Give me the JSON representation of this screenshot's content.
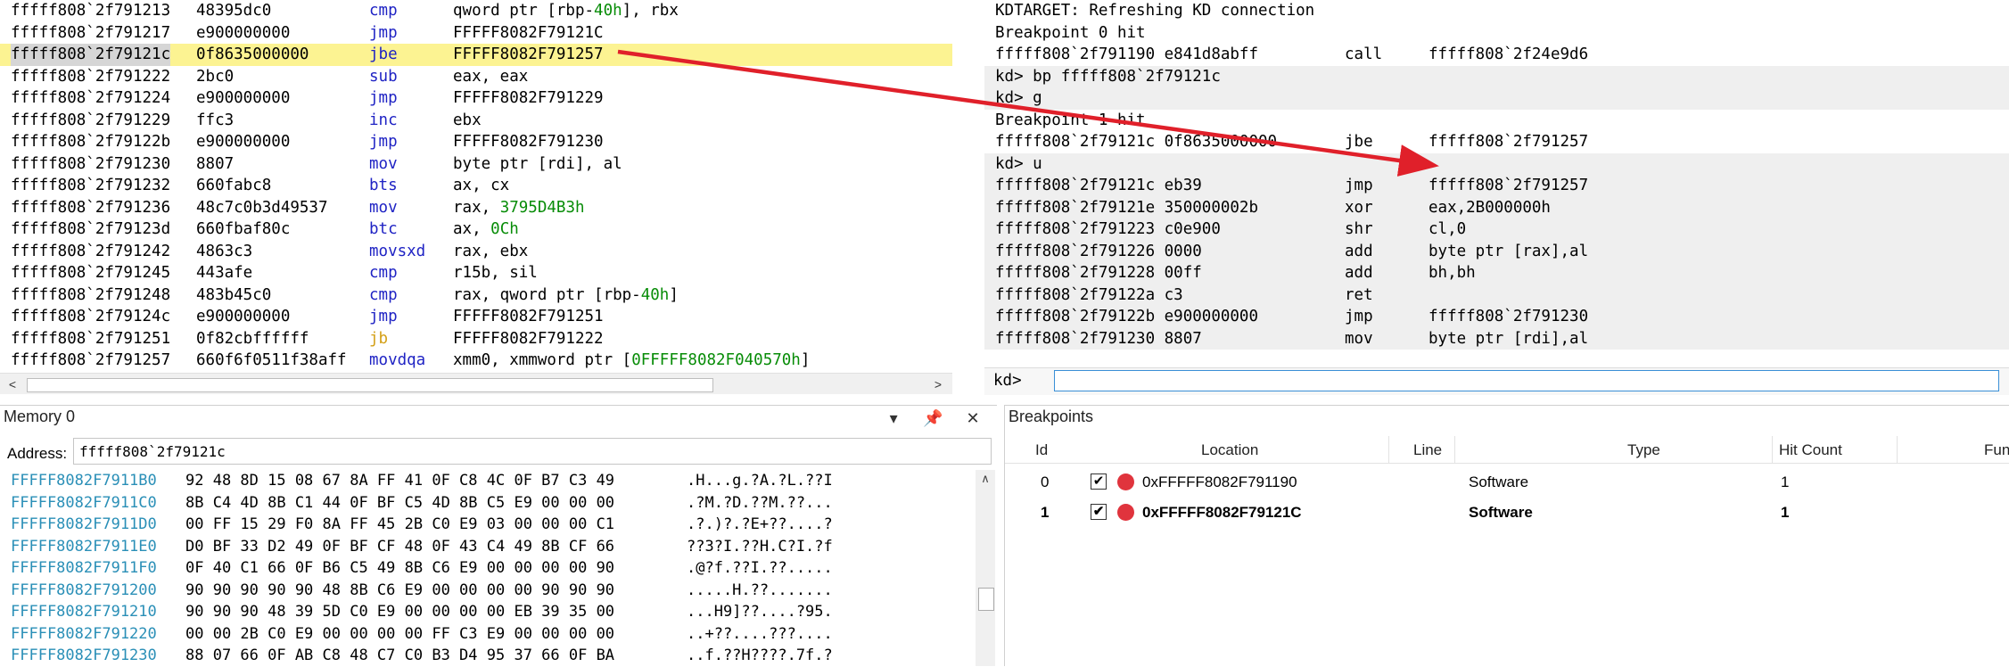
{
  "disassembly": {
    "lines": [
      {
        "addr": "fffff808`2f791213",
        "bytes": "48395dc0",
        "mn": "cmp",
        "op": [
          {
            "t": "qword ptr [rbp-"
          },
          {
            "t": "40h",
            "n": true
          },
          {
            "t": "], rbx"
          }
        ]
      },
      {
        "addr": "fffff808`2f791217",
        "bytes": "e900000000",
        "mn": "jmp",
        "op": [
          {
            "t": "FFFFF8082F79121C"
          }
        ]
      },
      {
        "addr": "fffff808`2f79121c",
        "bytes": "0f8635000000",
        "mn": "jbe",
        "op": [
          {
            "t": "FFFFF8082F791257"
          }
        ],
        "hl": true
      },
      {
        "addr": "fffff808`2f791222",
        "bytes": "2bc0",
        "mn": "sub",
        "op": [
          {
            "t": "eax, eax"
          }
        ]
      },
      {
        "addr": "fffff808`2f791224",
        "bytes": "e900000000",
        "mn": "jmp",
        "op": [
          {
            "t": "FFFFF8082F791229"
          }
        ]
      },
      {
        "addr": "fffff808`2f791229",
        "bytes": "ffc3",
        "mn": "inc",
        "op": [
          {
            "t": "ebx"
          }
        ]
      },
      {
        "addr": "fffff808`2f79122b",
        "bytes": "e900000000",
        "mn": "jmp",
        "op": [
          {
            "t": "FFFFF8082F791230"
          }
        ]
      },
      {
        "addr": "fffff808`2f791230",
        "bytes": "8807",
        "mn": "mov",
        "op": [
          {
            "t": "byte ptr [rdi], al"
          }
        ]
      },
      {
        "addr": "fffff808`2f791232",
        "bytes": "660fabc8",
        "mn": "bts",
        "op": [
          {
            "t": "ax, cx"
          }
        ]
      },
      {
        "addr": "fffff808`2f791236",
        "bytes": "48c7c0b3d49537",
        "mn": "mov",
        "op": [
          {
            "t": "rax, "
          },
          {
            "t": "3795D4B3h",
            "n": true
          }
        ]
      },
      {
        "addr": "fffff808`2f79123d",
        "bytes": "660fbaf80c",
        "mn": "btc",
        "op": [
          {
            "t": "ax, "
          },
          {
            "t": "0Ch",
            "n": true
          }
        ]
      },
      {
        "addr": "fffff808`2f791242",
        "bytes": "4863c3",
        "mn": "movsxd",
        "op": [
          {
            "t": "rax, ebx"
          }
        ]
      },
      {
        "addr": "fffff808`2f791245",
        "bytes": "443afe",
        "mn": "cmp",
        "op": [
          {
            "t": "r15b, sil"
          }
        ]
      },
      {
        "addr": "fffff808`2f791248",
        "bytes": "483b45c0",
        "mn": "cmp",
        "op": [
          {
            "t": "rax, qword ptr [rbp-"
          },
          {
            "t": "40h",
            "n": true
          },
          {
            "t": "]"
          }
        ]
      },
      {
        "addr": "fffff808`2f79124c",
        "bytes": "e900000000",
        "mn": "jmp",
        "op": [
          {
            "t": "FFFFF8082F791251"
          }
        ]
      },
      {
        "addr": "fffff808`2f791251",
        "bytes": "0f82cbffffff",
        "mn": "jb",
        "kw": true,
        "op": [
          {
            "t": "FFFFF8082F791222"
          }
        ]
      },
      {
        "addr": "fffff808`2f791257",
        "bytes": "660f6f0511f38aff",
        "mn": "movdqa",
        "op": [
          {
            "t": "xmm0, xmmword ptr ["
          },
          {
            "t": "0FFFFF8082F040570h",
            "n": true
          },
          {
            "t": "]"
          }
        ]
      }
    ]
  },
  "command": {
    "lines": [
      {
        "text": "KDTARGET: Refreshing KD connection",
        "shade": false
      },
      {
        "text": "Breakpoint 0 hit",
        "shade": false
      },
      {
        "cols": [
          "fffff808`2f791190 e841d8abff",
          "call",
          "fffff808`2f24e9d6"
        ],
        "shade": false
      },
      {
        "text": "kd> bp fffff808`2f79121c",
        "shade": true
      },
      {
        "text": "kd> g",
        "shade": true
      },
      {
        "text": "Breakpoint 1 hit",
        "shade": false
      },
      {
        "cols": [
          "fffff808`2f79121c 0f8635000000",
          "jbe",
          "fffff808`2f791257"
        ],
        "shade": false
      },
      {
        "text": "kd> u",
        "shade": true
      },
      {
        "cols": [
          "fffff808`2f79121c eb39",
          "jmp",
          "fffff808`2f791257"
        ],
        "shade": true
      },
      {
        "cols": [
          "fffff808`2f79121e 350000002b",
          "xor",
          "eax,2B000000h"
        ],
        "shade": true
      },
      {
        "cols": [
          "fffff808`2f791223 c0e900",
          "shr",
          "cl,0"
        ],
        "shade": true
      },
      {
        "cols": [
          "fffff808`2f791226 0000",
          "add",
          "byte ptr [rax],al"
        ],
        "shade": true
      },
      {
        "cols": [
          "fffff808`2f791228 00ff",
          "add",
          "bh,bh"
        ],
        "shade": true
      },
      {
        "cols": [
          "fffff808`2f79122a c3",
          "ret",
          ""
        ],
        "shade": true
      },
      {
        "cols": [
          "fffff808`2f79122b e900000000",
          "jmp",
          "fffff808`2f791230"
        ],
        "shade": true
      },
      {
        "cols": [
          "fffff808`2f791230 8807",
          "mov",
          "byte ptr [rdi],al"
        ],
        "shade": true
      }
    ],
    "prompt": "kd>",
    "input_value": ""
  },
  "memory": {
    "title": "Memory 0",
    "address_label": "Address:",
    "address_value": "fffff808`2f79121c",
    "rows": [
      {
        "addr": "FFFFF8082F7911B0",
        "bytes": "92 48 8D 15 08 67 8A FF 41 0F C8 4C 0F B7 C3 49",
        "ascii": ".H...g.?A.?L.??I"
      },
      {
        "addr": "FFFFF8082F7911C0",
        "bytes": "8B C4 4D 8B C1 44 0F BF C5 4D 8B C5 E9 00 00 00",
        "ascii": ".?M.?D.??M.??..."
      },
      {
        "addr": "FFFFF8082F7911D0",
        "bytes": "00 FF 15 29 F0 8A FF 45 2B C0 E9 03 00 00 00 C1",
        "ascii": ".?.)?.?E+??....?"
      },
      {
        "addr": "FFFFF8082F7911E0",
        "bytes": "D0 BF 33 D2 49 0F BF CF 48 0F 43 C4 49 8B CF 66",
        "ascii": "??3?I.??H.C?I.?f"
      },
      {
        "addr": "FFFFF8082F7911F0",
        "bytes": "0F 40 C1 66 0F B6 C5 49 8B C6 E9 00 00 00 00 90",
        "ascii": ".@?f.??I.??....."
      },
      {
        "addr": "FFFFF8082F791200",
        "bytes": "90 90 90 90 90 48 8B C6 E9 00 00 00 00 90 90 90",
        "ascii": ".....H.??......."
      },
      {
        "addr": "FFFFF8082F791210",
        "bytes": "90 90 90 48 39 5D C0 E9 00 00 00 00 EB 39 35 00",
        "ascii": "...H9]??....?95."
      },
      {
        "addr": "FFFFF8082F791220",
        "bytes": "00 00 2B C0 E9 00 00 00 00 FF C3 E9 00 00 00 00",
        "ascii": "..+??....???...."
      },
      {
        "addr": "FFFFF8082F791230",
        "bytes": "88 07 66 0F AB C8 48 C7 C0 B3 D4 95 37 66 0F BA",
        "ascii": "..f.??H????.7f.?"
      }
    ]
  },
  "breakpoints": {
    "title": "Breakpoints",
    "columns": [
      "Id",
      "Location",
      "Line",
      "Type",
      "Hit Count",
      "Fun"
    ],
    "rows": [
      {
        "id": "0",
        "location": "0xFFFFF8082F791190",
        "line": "",
        "type": "Software",
        "hits": "1",
        "enabled": true,
        "bold": false
      },
      {
        "id": "1",
        "location": "0xFFFFF8082F79121C",
        "line": "",
        "type": "Software",
        "hits": "1",
        "enabled": true,
        "bold": true
      }
    ]
  },
  "colors": {
    "highlight_line": "#fcf392",
    "mnemonic": "#1f23c4",
    "number": "#078c07",
    "memory_address": "#2a8fb7",
    "annotation_arrow": "#e0202a",
    "breakpoint_dot": "#e0343d"
  }
}
